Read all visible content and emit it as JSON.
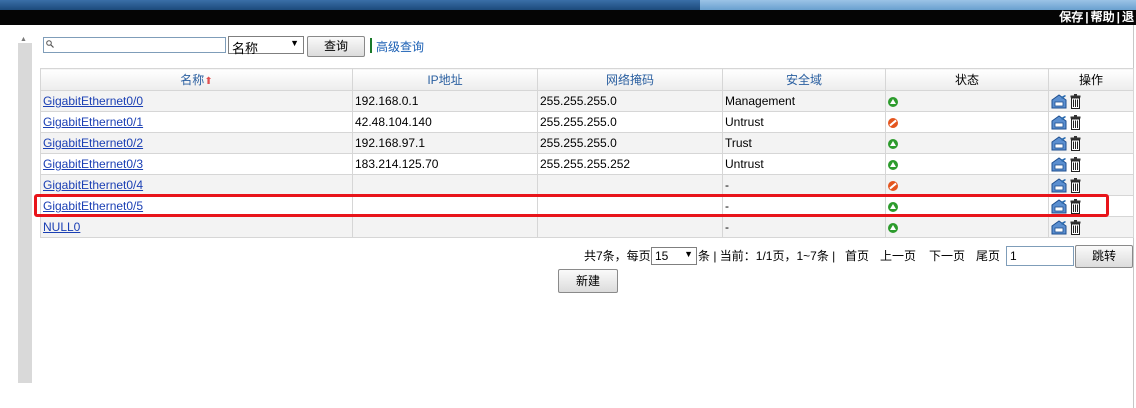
{
  "header": {
    "links": [
      "保存",
      "帮助",
      "退"
    ]
  },
  "search": {
    "value": "",
    "placeholder": "",
    "field_selected": "名称",
    "query_label": "查询",
    "advanced_label": "高级查询"
  },
  "table": {
    "columns": [
      "名称",
      "IP地址",
      "网络掩码",
      "安全域",
      "状态",
      "操作"
    ],
    "sort_indicator": "⬆",
    "rows": [
      {
        "name": "GigabitEthernet0/0",
        "ip": "192.168.0.1",
        "mask": "255.255.255.0",
        "zone": "Management",
        "status": "up"
      },
      {
        "name": "GigabitEthernet0/1",
        "ip": "42.48.104.140",
        "mask": "255.255.255.0",
        "zone": "Untrust",
        "status": "down"
      },
      {
        "name": "GigabitEthernet0/2",
        "ip": "192.168.97.1",
        "mask": "255.255.255.0",
        "zone": "Trust",
        "status": "up"
      },
      {
        "name": "GigabitEthernet0/3",
        "ip": "183.214.125.70",
        "mask": "255.255.255.252",
        "zone": "Untrust",
        "status": "up"
      },
      {
        "name": "GigabitEthernet0/4",
        "ip": "",
        "mask": "",
        "zone": "-",
        "status": "down"
      },
      {
        "name": "GigabitEthernet0/5",
        "ip": "",
        "mask": "",
        "zone": "-",
        "status": "up"
      },
      {
        "name": "NULL0",
        "ip": "",
        "mask": "",
        "zone": "-",
        "status": "up"
      }
    ]
  },
  "pager": {
    "total_prefix": "共7条，每页",
    "per_page": "15",
    "per_page_suffix": "条 | 当前：1/1页，1~7条 |",
    "first": "首页",
    "prev": "上一页",
    "next": "下一页",
    "last": "尾页",
    "jump_value": "1",
    "jump_label": "跳转"
  },
  "actions": {
    "new_label": "新建"
  },
  "colors": {
    "highlight": "#e8141a",
    "link": "#1a3fb4",
    "status_up": "#2c9b2c",
    "status_down": "#e4551e"
  }
}
